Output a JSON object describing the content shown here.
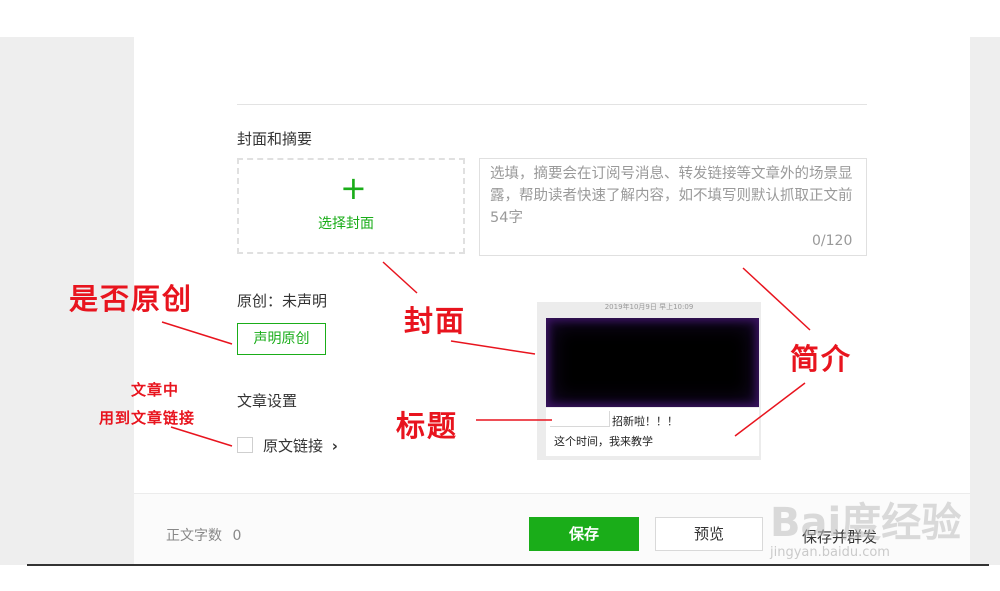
{
  "cover_section": {
    "title": "封面和摘要",
    "choose_cover_label": "选择封面",
    "summary_placeholder": "选填，摘要会在订阅号消息、转发链接等文章外的场景显露，帮助读者快速了解内容，如不填写则默认抓取正文前54字",
    "summary_count": "0/120"
  },
  "original": {
    "status": "原创：未声明",
    "declare_button": "声明原创"
  },
  "settings": {
    "title": "文章设置",
    "source_link_label": "原文链接",
    "source_link_chevron": "›"
  },
  "preview_card": {
    "date": "2019年10月9日 早上10:09",
    "headline": "招新啦！！！",
    "description": "这个时间，我来教学"
  },
  "footer": {
    "word_count_label": "正文字数",
    "word_count_value": "0",
    "save_label": "保存",
    "preview_label": "预览",
    "send_label": "保存并群发"
  },
  "annotations": {
    "is_original": "是否原创",
    "cover": "封面",
    "intro": "简介",
    "title": "标题",
    "used_line1": "文章中",
    "used_line2": "用到文章链接"
  },
  "watermark": {
    "brand": "Bai度经验",
    "url": "jingyan.baidu.com"
  },
  "colors": {
    "accent": "#1aad19",
    "annotation": "#e8141e"
  }
}
